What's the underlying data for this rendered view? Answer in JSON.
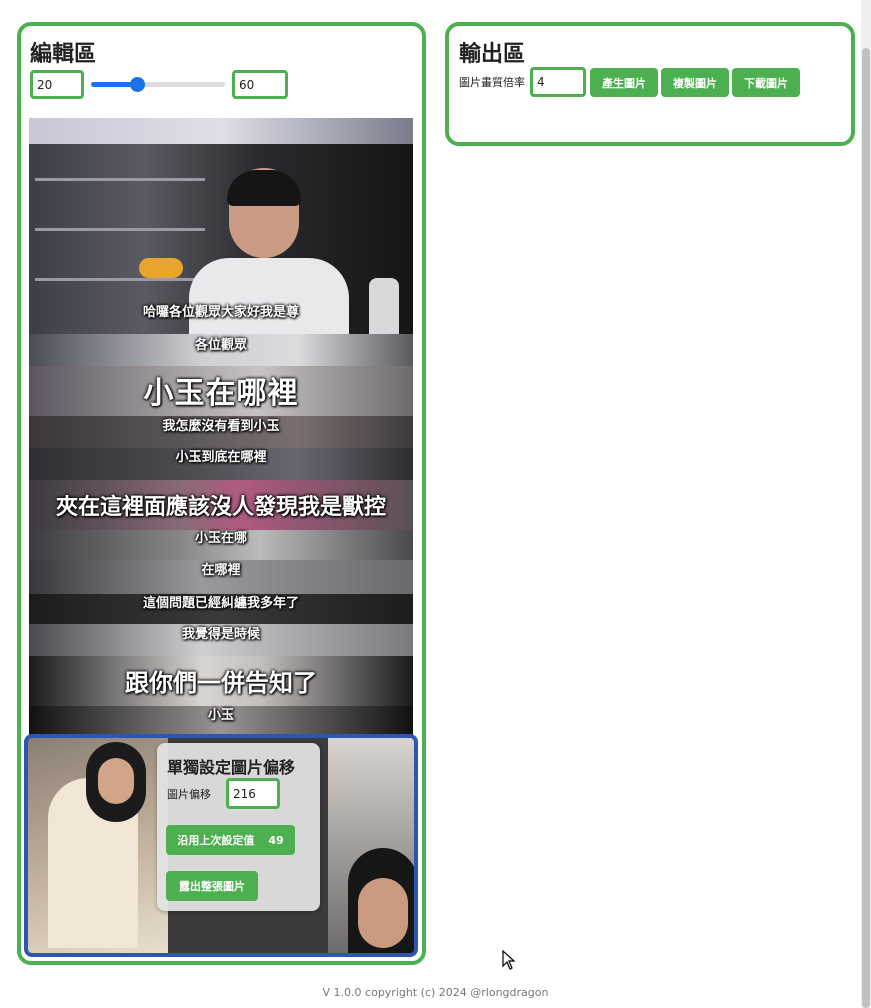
{
  "editor": {
    "title": "編輯區",
    "start_value": "20",
    "end_value": "60",
    "slider_fraction": 0.34,
    "captions": [
      "哈囉各位觀眾大家好我是尊",
      "各位觀眾",
      "小玉在哪裡",
      "我怎麼沒有看到小玉",
      "小玉到底在哪裡",
      "夾在這裡面應該沒人發現我是獸控",
      "小玉在哪",
      "在哪裡",
      "這個問題已經糾纏我多年了",
      "我覺得是時候",
      "跟你們一併告知了",
      "小玉"
    ]
  },
  "popup": {
    "title": "單獨設定圖片偏移",
    "offset_label": "圖片偏移",
    "offset_value": "216",
    "reuse_label": "沿用上次設定值",
    "reuse_count": "49",
    "reveal_label": "露出整張圖片"
  },
  "output": {
    "title": "輸出區",
    "scale_label": "圖片畫質倍率",
    "scale_value": "4",
    "generate_label": "產生圖片",
    "copy_label": "複製圖片",
    "download_label": "下載圖片"
  },
  "footer": {
    "text": "V 1.0.0 copyright (c) 2024 @rlongdragon"
  },
  "colors": {
    "accent": "#4caf50",
    "selected_border": "#2e55b3",
    "slider": "#1a73e8"
  }
}
